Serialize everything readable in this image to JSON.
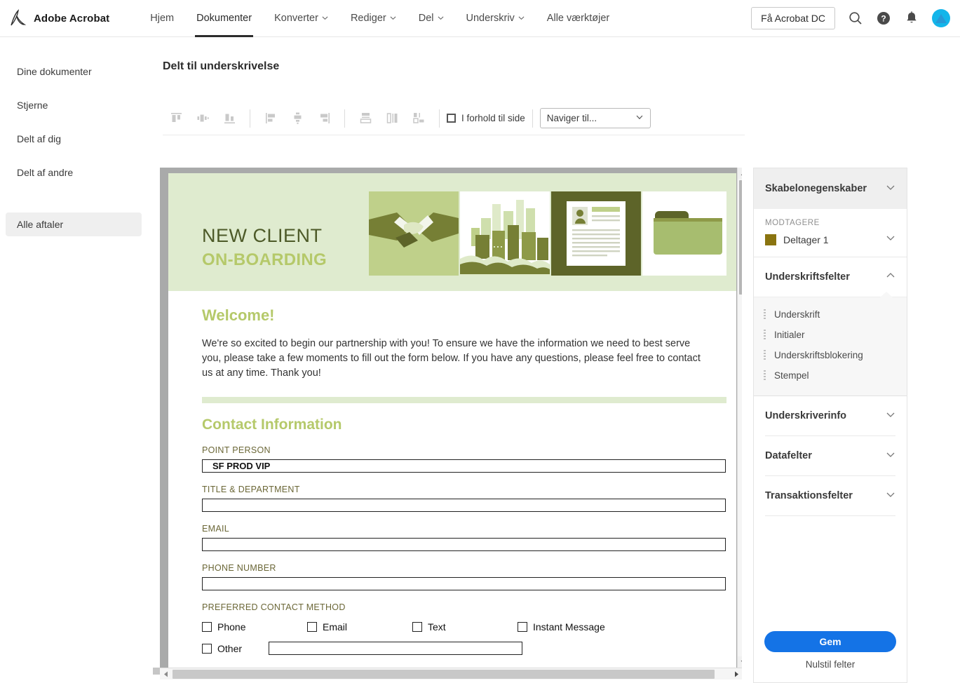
{
  "app": {
    "brand": "Adobe Acrobat",
    "logo_icon": "adobe-acrobat-logo"
  },
  "topnav": {
    "items": [
      {
        "label": "Hjem",
        "has_caret": false,
        "active": false
      },
      {
        "label": "Dokumenter",
        "has_caret": false,
        "active": true
      },
      {
        "label": "Konverter",
        "has_caret": true,
        "active": false
      },
      {
        "label": "Rediger",
        "has_caret": true,
        "active": false
      },
      {
        "label": "Del",
        "has_caret": true,
        "active": false
      },
      {
        "label": "Underskriv",
        "has_caret": true,
        "active": false
      },
      {
        "label": "Alle værktøjer",
        "has_caret": false,
        "active": false
      }
    ],
    "cta_label": "Få Acrobat DC",
    "icons": [
      "search-icon",
      "help-icon",
      "notifications-icon",
      "avatar"
    ]
  },
  "sidebar": {
    "items": [
      {
        "label": "Dine dokumenter",
        "selected": false
      },
      {
        "label": "Stjerne",
        "selected": false
      },
      {
        "label": "Delt af dig",
        "selected": false
      },
      {
        "label": "Delt af andre",
        "selected": false
      }
    ],
    "bottom_items": [
      {
        "label": "Alle aftaler",
        "selected": true
      }
    ]
  },
  "main": {
    "page_title": "Delt til underskrivelse"
  },
  "toolbar": {
    "align_tools": [
      "align-top-icon",
      "align-horizontal-center-icon",
      "align-bottom-icon",
      "align-left-icon",
      "align-vertical-center-icon",
      "align-right-icon"
    ],
    "distribute_tools": [
      "distribute-vertical-icon",
      "distribute-horizontal-icon",
      "match-size-icon"
    ],
    "relative_checkbox": {
      "label": "I forhold til side",
      "checked": false
    },
    "navigate_select": {
      "value": "Naviger til...",
      "icon": "chevron-down-icon"
    }
  },
  "document": {
    "hero": {
      "title": "NEW CLIENT",
      "subtitle": "ON-BOARDING",
      "art_icon": "onboarding-illustration",
      "bg_color": "#dfebcf",
      "title_color": "#4d5a28",
      "subtitle_color": "#b5c96a"
    },
    "welcome_heading": "Welcome!",
    "welcome_body": "We're so excited to begin our partnership with you! To ensure we have the information we need to best serve you, please take a few moments to fill out the form below. If you have any questions, please feel free to contact us at any time. Thank you!",
    "section_heading": "Contact Information",
    "fields": [
      {
        "label": "POINT PERSON",
        "value": "SF PROD VIP"
      },
      {
        "label": "TITLE & DEPARTMENT",
        "value": ""
      },
      {
        "label": "EMAIL",
        "value": ""
      },
      {
        "label": "PHONE NUMBER",
        "value": ""
      }
    ],
    "contact_method": {
      "label": "PREFERRED CONTACT METHOD",
      "options": [
        {
          "label": "Phone",
          "checked": false
        },
        {
          "label": "Email",
          "checked": false
        },
        {
          "label": "Text",
          "checked": false
        },
        {
          "label": "Instant Message",
          "checked": false
        }
      ],
      "other": {
        "label": "Other",
        "checked": false,
        "value": ""
      }
    }
  },
  "right_panel": {
    "header": {
      "title": "Skabelonegenskaber",
      "icon": "chevron-down-icon"
    },
    "recipients": {
      "caption": "MODTAGERE",
      "name": "Deltager 1",
      "color": "#8a7410",
      "icon": "chevron-down-icon"
    },
    "sections": [
      {
        "title": "Underskriftsfelter",
        "expanded": true,
        "icon": "chevron-up-icon",
        "fields": [
          "Underskrift",
          "Initialer",
          "Underskriftsblokering",
          "Stempel"
        ]
      },
      {
        "title": "Underskriverinfo",
        "expanded": false,
        "icon": "chevron-down-icon"
      },
      {
        "title": "Datafelter",
        "expanded": false,
        "icon": "chevron-down-icon"
      },
      {
        "title": "Transaktionsfelter",
        "expanded": false,
        "icon": "chevron-down-icon"
      }
    ],
    "save_label": "Gem",
    "reset_label": "Nulstil felter"
  },
  "scrollbars": {
    "vertical": {
      "up_icon": "scroll-up-arrow-icon",
      "down_icon": "scroll-down-arrow-icon"
    },
    "horizontal": {
      "left_icon": "scroll-left-arrow-icon",
      "right_icon": "scroll-right-arrow-icon"
    }
  }
}
